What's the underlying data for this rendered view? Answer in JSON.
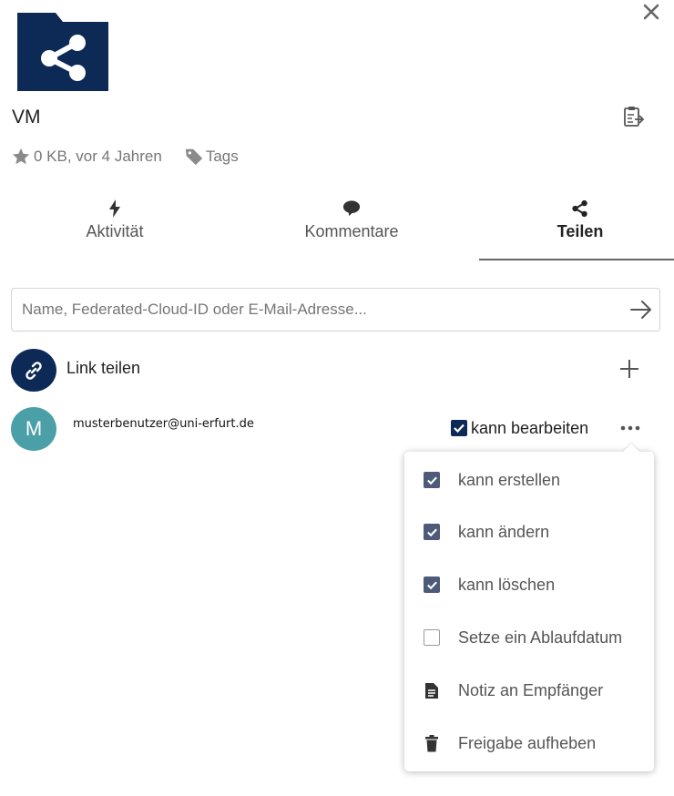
{
  "header": {
    "file_name": "VM",
    "size_time": "0 KB, vor 4 Jahren",
    "tags_label": "Tags"
  },
  "tabs": [
    {
      "label": "Aktivität",
      "icon": "lightning-icon"
    },
    {
      "label": "Kommentare",
      "icon": "comment-icon"
    },
    {
      "label": "Teilen",
      "icon": "share-icon",
      "active": true
    }
  ],
  "search": {
    "placeholder": "Name, Federated-Cloud-ID oder E-Mail-Adresse..."
  },
  "link_share": {
    "label": "Link teilen"
  },
  "user_share": {
    "avatar_letter": "M",
    "email": "musterbenutzer@uni-erfurt.de",
    "permission_label": "kann bearbeiten",
    "permission_checked": true
  },
  "menu": {
    "items": [
      {
        "label": "kann erstellen",
        "type": "checkbox",
        "checked": true
      },
      {
        "label": "kann ändern",
        "type": "checkbox",
        "checked": true
      },
      {
        "label": "kann löschen",
        "type": "checkbox",
        "checked": true
      },
      {
        "label": "Setze ein Ablaufdatum",
        "type": "checkbox",
        "checked": false
      },
      {
        "label": "Notiz an Empfänger",
        "type": "action",
        "icon": "note-icon"
      },
      {
        "label": "Freigabe aufheben",
        "type": "action",
        "icon": "trash-icon"
      }
    ]
  },
  "colors": {
    "brand": "#0d2a57",
    "avatar": "#4ba0a8",
    "checkbox": "#4d5a78"
  }
}
